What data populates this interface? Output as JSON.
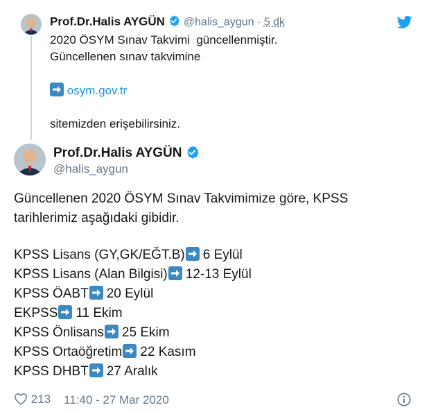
{
  "quoted_tweet": {
    "author_name": "Prof.Dr.Halis AYGÜN",
    "handle": "@halis_aygun",
    "separator": "·",
    "time": "5 dk",
    "line1": "2020 ÖSYM Sınav Takvimi  güncellenmiştir.",
    "line2": "Güncellenen sınav takvimine",
    "link_text": "osym.gov.tr",
    "line3": "sitemizden erişebilirsiniz."
  },
  "main_tweet": {
    "author_name": "Prof.Dr.Halis AYGÜN",
    "handle": "@halis_aygun",
    "intro_line1": "Güncellenen 2020 ÖSYM Sınav Takvimimize göre, KPSS",
    "intro_line2": "tarihlerimiz aşağıdaki gibidir.",
    "exams": [
      {
        "name": "KPSS Lisans (GY,GK/EĞT.B)",
        "date": "6 Eylül"
      },
      {
        "name": "KPSS Lisans (Alan Bilgisi)",
        "date": "12-13 Eylül"
      },
      {
        "name": "KPSS ÖABT",
        "date": "20 Eylül"
      },
      {
        "name": "EKPSS",
        "date": "11 Ekim"
      },
      {
        "name": "KPSS Önlisans",
        "date": "25 Ekim"
      },
      {
        "name": "KPSS Ortaöğretim",
        "date": "22 Kasım"
      },
      {
        "name": "KPSS DHBT",
        "date": "27 Aralık"
      }
    ],
    "like_count": "213",
    "timestamp": "11:40 - 27 Mar 2020"
  },
  "icons": {
    "verified": "verified-badge-icon",
    "arrow": "right-arrow-emoji-icon",
    "like": "heart-icon",
    "info": "info-icon",
    "brand": "twitter-bird-icon"
  },
  "colors": {
    "verified_blue": "#1da1f2",
    "arrow_blue": "#3b88c3",
    "link_blue": "#1b95e0",
    "muted_gray": "#657786"
  }
}
